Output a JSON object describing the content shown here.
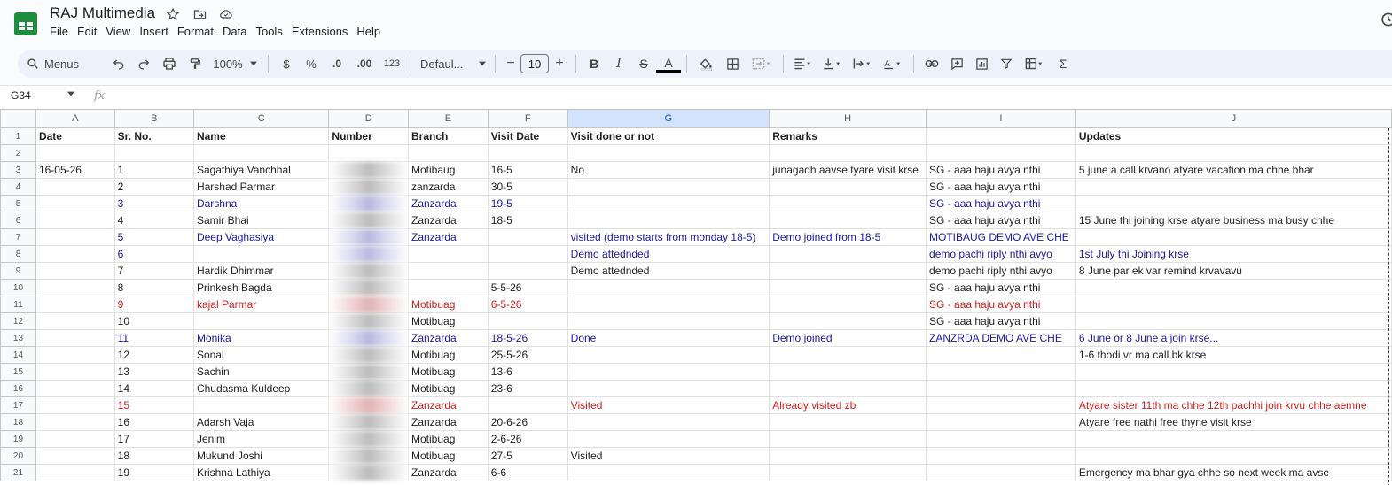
{
  "doc": {
    "title": "RAJ Multimedia"
  },
  "menu": [
    "File",
    "Edit",
    "View",
    "Insert",
    "Format",
    "Data",
    "Tools",
    "Extensions",
    "Help"
  ],
  "toolbar": {
    "search_label": "Menus",
    "zoom": "100%",
    "currency": "$",
    "percent": "%",
    "dec_decrease": ".0",
    "dec_increase": ".00",
    "number_format": "123",
    "font": "Defaul...",
    "font_size": "10",
    "minus": "−",
    "plus": "+",
    "bold": "B",
    "italic": "I",
    "strike": "S",
    "text_color": "A",
    "sum": "Σ"
  },
  "formula_bar": {
    "cell_ref": "G34",
    "fx": "fx",
    "value": ""
  },
  "grid": {
    "columns": [
      "A",
      "B",
      "C",
      "D",
      "E",
      "F",
      "G",
      "H",
      "I",
      "J"
    ],
    "selected_column": "G",
    "rows": [
      {
        "n": "1",
        "cells": [
          "Date",
          "Sr. No.",
          "Name",
          "Number",
          "Branch",
          "Visit Date",
          "Visit done or not",
          "Remarks",
          "",
          "Updates"
        ]
      },
      {
        "n": "2",
        "cells": [
          "",
          "",
          "",
          "",
          "",
          "",
          "",
          "",
          "",
          ""
        ]
      },
      {
        "n": "3",
        "cells": [
          "16-05-26",
          "1",
          "Sagathiya Vanchhal",
          "",
          "Motibaug",
          "16-5",
          "No",
          "junagadh aavse tyare visit krse",
          "SG - aaa haju avya nthi",
          "5 june a call krvano atyare vacation ma chhe bhar"
        ]
      },
      {
        "n": "4",
        "cells": [
          "",
          "2",
          "Harshad Parmar",
          "",
          "zanzarda",
          "30-5",
          "",
          "",
          "SG - aaa haju avya nthi",
          ""
        ]
      },
      {
        "n": "5",
        "cells": [
          "",
          "3",
          "Darshna",
          "",
          "Zanzarda",
          "19-5",
          "",
          "",
          "SG - aaa haju avya nthi",
          ""
        ]
      },
      {
        "n": "6",
        "cells": [
          "",
          "4",
          "Samir Bhai",
          "",
          "Zanzarda",
          "18-5",
          "",
          "",
          "SG - aaa haju avya nthi",
          "15 June thi joining krse atyare business ma busy chhe"
        ]
      },
      {
        "n": "7",
        "cells": [
          "",
          "5",
          "Deep Vaghasiya",
          "",
          "Zanzarda",
          "",
          "visited (demo starts from monday 18-5)",
          "Demo joined from 18-5",
          "MOTIBAUG DEMO  AVE CHE",
          ""
        ]
      },
      {
        "n": "8",
        "cells": [
          "",
          "6",
          "",
          "",
          "",
          "",
          "Demo attednded",
          "",
          "demo pachi riply nthi avyo",
          "1st July thi Joining krse"
        ]
      },
      {
        "n": "9",
        "cells": [
          "",
          "7",
          "Hardik Dhimmar",
          "",
          "",
          "",
          "Demo attednded",
          "",
          "demo pachi riply nthi avyo",
          "8 June par ek var remind krvavavu"
        ]
      },
      {
        "n": "10",
        "cells": [
          "",
          "8",
          "Prinkesh Bagda",
          "",
          "",
          "5-5-26",
          "",
          "",
          "SG - aaa haju avya nthi",
          ""
        ]
      },
      {
        "n": "11",
        "cells": [
          "",
          "9",
          "kajal Parmar",
          "",
          "Motibuag",
          "6-5-26",
          "",
          "",
          "SG - aaa haju avya nthi",
          ""
        ]
      },
      {
        "n": "12",
        "cells": [
          "",
          "10",
          "",
          "",
          "Motibuag",
          "",
          "",
          "",
          "SG - aaa haju avya nthi",
          ""
        ]
      },
      {
        "n": "13",
        "cells": [
          "",
          "11",
          "Monika",
          "",
          "Zanzarda",
          "18-5-26",
          "Done",
          "Demo joined",
          "ZANZRDA DEMO AVE CHE",
          "6 June or 8 June a join krse..."
        ]
      },
      {
        "n": "14",
        "cells": [
          "",
          "12",
          "Sonal",
          "",
          "Motibuag",
          "25-5-26",
          "",
          "",
          "",
          "1-6 thodi vr ma call bk krse"
        ]
      },
      {
        "n": "15",
        "cells": [
          "",
          "13",
          "Sachin",
          "",
          "Motibuag",
          "13-6",
          "",
          "",
          "",
          ""
        ]
      },
      {
        "n": "16",
        "cells": [
          "",
          "14",
          "Chudasma Kuldeep",
          "",
          "Motibuag",
          "23-6",
          "",
          "",
          "",
          ""
        ]
      },
      {
        "n": "17",
        "cells": [
          "",
          "15",
          "",
          "",
          "Zanzarda",
          "",
          "Visited",
          "Already visited zb",
          "",
          "Atyare sister 11th ma chhe 12th pachhi join krvu chhe aemne"
        ]
      },
      {
        "n": "18",
        "cells": [
          "",
          "16",
          "Adarsh Vaja",
          "",
          "Zanzarda",
          "20-6-26",
          "",
          "",
          "",
          "Atyare free nathi free thyne visit krse"
        ]
      },
      {
        "n": "19",
        "cells": [
          "",
          "17",
          "Jenim",
          "",
          "Motibuag",
          "2-6-26",
          "",
          "",
          "",
          ""
        ]
      },
      {
        "n": "20",
        "cells": [
          "",
          "18",
          "Mukund Joshi",
          "",
          "Motibuag",
          "27-5",
          "Visited",
          "",
          "",
          ""
        ]
      },
      {
        "n": "21",
        "cells": [
          "",
          "19",
          "Krishna Lathiya",
          "",
          "Zanzarda",
          "6-6",
          "",
          "",
          "",
          "Emergency ma bhar gya chhe so next week ma avse"
        ]
      }
    ],
    "blue_rows": [
      "5",
      "7",
      "8",
      "13"
    ],
    "red_rows": [
      "11",
      "17"
    ]
  },
  "colors": {
    "blue_text": "#1a1aa6",
    "red_text": "#d11f1f",
    "selected_header": "#d3e3fd"
  }
}
